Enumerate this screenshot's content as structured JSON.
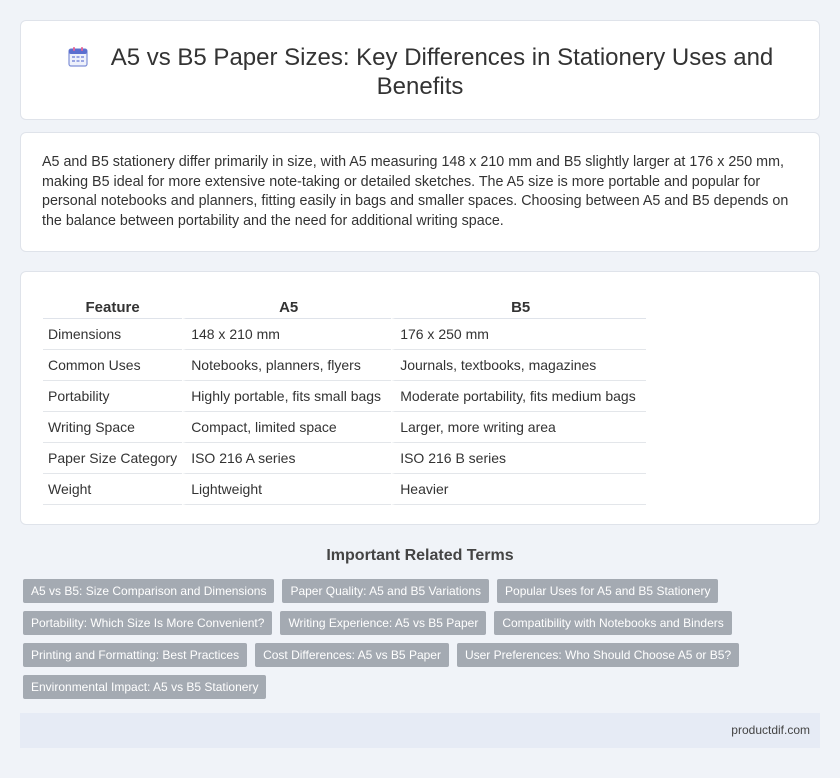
{
  "header": {
    "title": "A5 vs B5 Paper Sizes: Key Differences in Stationery Uses and Benefits",
    "icon": "calendar-icon"
  },
  "intro": {
    "text": "A5 and B5 stationery differ primarily in size, with A5 measuring 148 x 210 mm and B5 slightly larger at 176 x 250 mm, making B5 ideal for more extensive note-taking or detailed sketches. The A5 size is more portable and popular for personal notebooks and planners, fitting easily in bags and smaller spaces. Choosing between A5 and B5 depends on the balance between portability and the need for additional writing space."
  },
  "table": {
    "headers": [
      "Feature",
      "A5",
      "B5"
    ],
    "rows": [
      [
        "Dimensions",
        "148 x 210 mm",
        "176 x 250 mm"
      ],
      [
        "Common Uses",
        "Notebooks, planners, flyers",
        "Journals, textbooks, magazines"
      ],
      [
        "Portability",
        "Highly portable, fits small bags",
        "Moderate portability, fits medium bags"
      ],
      [
        "Writing Space",
        "Compact, limited space",
        "Larger, more writing area"
      ],
      [
        "Paper Size Category",
        "ISO 216 A series",
        "ISO 216 B series"
      ],
      [
        "Weight",
        "Lightweight",
        "Heavier"
      ]
    ]
  },
  "related": {
    "heading": "Important Related Terms",
    "tags": [
      [
        "A5 vs B5: Size Comparison and Dimensions",
        "Paper Quality: A5 and B5 Variations",
        "Popular Uses for A5 and B5 Stationery"
      ],
      [
        "Portability: Which Size Is More Convenient?",
        "Writing Experience: A5 vs B5 Paper",
        "Compatibility with Notebooks and Binders"
      ],
      [
        "Printing and Formatting: Best Practices",
        "Cost Differences: A5 vs B5 Paper",
        "User Preferences: Who Should Choose A5 or B5?"
      ],
      [
        "Environmental Impact: A5 vs B5 Stationery"
      ]
    ]
  },
  "footer": {
    "site": "productdif.com"
  },
  "colors": {
    "background": "#f0f3f8",
    "tag": "#a4aab2",
    "footer": "#e6ebf5"
  }
}
